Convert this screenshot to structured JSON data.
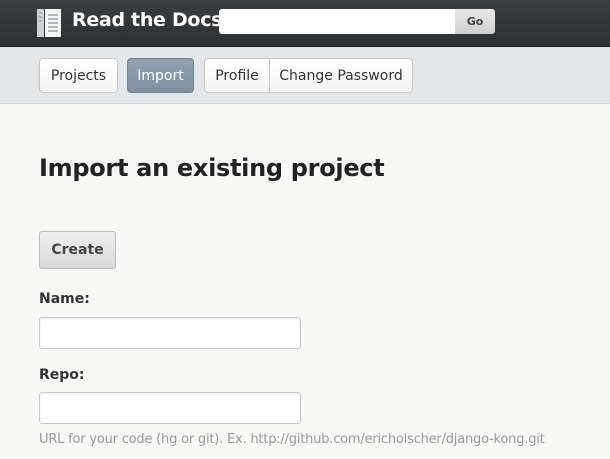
{
  "header": {
    "brand": "Read the Docs",
    "logo_icon": "book-stack-icon",
    "search": {
      "value": "",
      "placeholder": "",
      "go_label": "Go"
    }
  },
  "subnav": {
    "items": [
      {
        "label": "Projects",
        "active": false
      },
      {
        "label": "Import",
        "active": true
      },
      {
        "label": "Profile",
        "active": false
      },
      {
        "label": "Change Password",
        "active": false
      }
    ]
  },
  "main": {
    "title": "Import an existing project",
    "create_label": "Create",
    "form": {
      "name_label": "Name:",
      "name_value": "",
      "repo_label": "Repo:",
      "repo_value": "",
      "repo_help": "URL for your code (hg or git). Ex. http://github.com/ericholscher/django-kong.git"
    }
  },
  "colors": {
    "header_bg": "#2e3032",
    "subnav_bg": "#e4e6e8",
    "active_tab": "#8596a3",
    "page_bg": "#f7f7f6"
  }
}
